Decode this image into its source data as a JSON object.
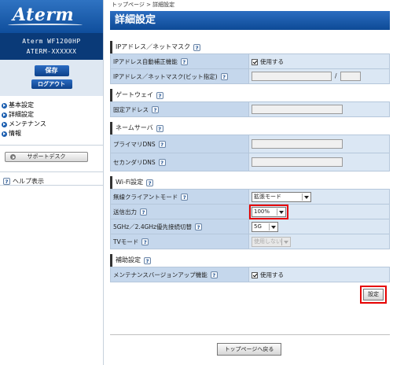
{
  "sidebar": {
    "logo": "Aterm",
    "model_line1": "Aterm WF1200HP",
    "model_line2": "ATERM-XXXXXX",
    "save_label": "保存",
    "logout_label": "ログアウト",
    "nav": [
      {
        "label": "基本設定"
      },
      {
        "label": "詳細設定"
      },
      {
        "label": "メンテナンス"
      },
      {
        "label": "情報"
      }
    ],
    "support_label": "サポートデスク",
    "help_icon": "?",
    "help_label": "ヘルプ表示"
  },
  "main": {
    "breadcrumb": "トップページ > 詳細設定",
    "title": "詳細設定",
    "help_icon": "?",
    "sections": {
      "ip": {
        "title": "IPアドレス／ネットマスク",
        "auto_label": "IPアドレス自動補正機能",
        "auto_value": "使用する",
        "mask_label": "IPアドレス／ネットマスク(ビット指定)",
        "slash": "/"
      },
      "gateway": {
        "title": "ゲートウェイ",
        "fixed_label": "固定アドレス"
      },
      "dns": {
        "title": "ネームサーバ",
        "primary_label": "プライマリDNS",
        "secondary_label": "セカンダリDNS"
      },
      "wifi": {
        "title": "Wi-Fi設定",
        "client_mode_label": "無線クライアントモード",
        "client_mode_value": "拡張モード",
        "tx_power_label": "送信出力",
        "tx_power_value": "100%",
        "band_label": "5GHz／2.4GHz優先接続切替",
        "band_value": "5G",
        "tv_label": "TVモード",
        "tv_value": "使用しない"
      },
      "aux": {
        "title": "補助設定",
        "maint_label": "メンテナンスバージョンアップ機能",
        "maint_value": "使用する"
      }
    },
    "set_label": "設定",
    "back_label": "トップページへ戻る"
  }
}
